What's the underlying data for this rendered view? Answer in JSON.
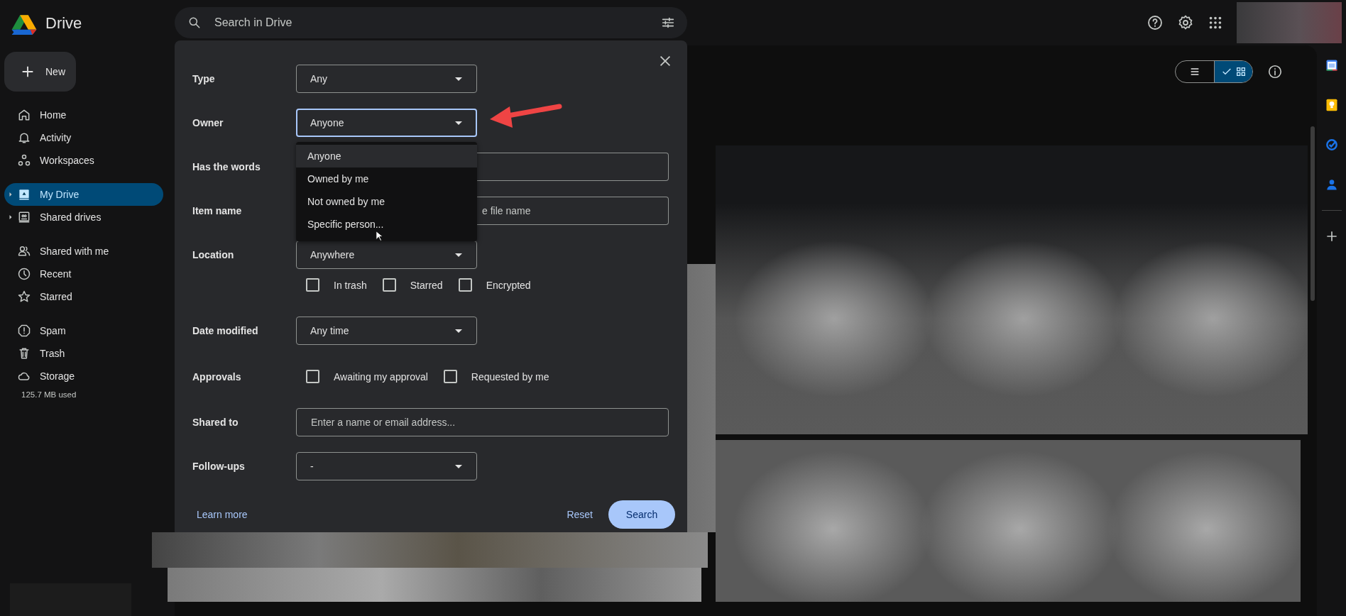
{
  "app": {
    "name": "Drive"
  },
  "new_button": {
    "label": "New"
  },
  "sidebar": {
    "groups": [
      [
        {
          "label": "Home",
          "selected": false,
          "expandable": false
        },
        {
          "label": "Activity",
          "selected": false,
          "expandable": false
        },
        {
          "label": "Workspaces",
          "selected": false,
          "expandable": false
        }
      ],
      [
        {
          "label": "My Drive",
          "selected": true,
          "expandable": true
        },
        {
          "label": "Shared drives",
          "selected": false,
          "expandable": true
        }
      ],
      [
        {
          "label": "Shared with me",
          "selected": false,
          "expandable": false
        },
        {
          "label": "Recent",
          "selected": false,
          "expandable": false
        },
        {
          "label": "Starred",
          "selected": false,
          "expandable": false
        }
      ],
      [
        {
          "label": "Spam",
          "selected": false,
          "expandable": false
        },
        {
          "label": "Trash",
          "selected": false,
          "expandable": false
        },
        {
          "label": "Storage",
          "selected": false,
          "expandable": false
        }
      ]
    ],
    "storage_used": "125.7 MB used"
  },
  "search": {
    "placeholder": "Search in Drive"
  },
  "dialog": {
    "rows": [
      {
        "kind": "select",
        "label": "Type",
        "value": "Any",
        "focused": false
      },
      {
        "kind": "select",
        "label": "Owner",
        "value": "Anyone",
        "focused": true,
        "menu": [
          {
            "label": "Anyone",
            "selected": true
          },
          {
            "label": "Owned by me",
            "selected": false
          },
          {
            "label": "Not owned by me",
            "selected": false
          },
          {
            "label": "Specific person...",
            "selected": false
          }
        ]
      },
      {
        "kind": "text",
        "label": "Has the words"
      },
      {
        "kind": "text",
        "label": "Item name",
        "placeholder": "e file name"
      },
      {
        "kind": "select",
        "label": "Location",
        "value": "Anywhere",
        "focused": false
      },
      {
        "kind": "checks",
        "options": [
          {
            "label": "In trash",
            "checked": false
          },
          {
            "label": "Starred",
            "checked": false
          },
          {
            "label": "Encrypted",
            "checked": false
          }
        ]
      },
      {
        "kind": "select",
        "label": "Date modified",
        "value": "Any time",
        "focused": false
      },
      {
        "kind": "checks",
        "label": "Approvals",
        "options": [
          {
            "label": "Awaiting my approval",
            "checked": false
          },
          {
            "label": "Requested by me",
            "checked": false
          }
        ]
      },
      {
        "kind": "text",
        "label": "Shared to",
        "placeholder": "Enter a name or email address..."
      },
      {
        "kind": "select",
        "label": "Follow-ups",
        "value": "-",
        "focused": false
      }
    ],
    "learn_more": "Learn more",
    "reset": "Reset",
    "search": "Search"
  },
  "view_toggle": [
    {
      "kind": "list",
      "selected": false
    },
    {
      "kind": "grid",
      "selected": true
    }
  ]
}
